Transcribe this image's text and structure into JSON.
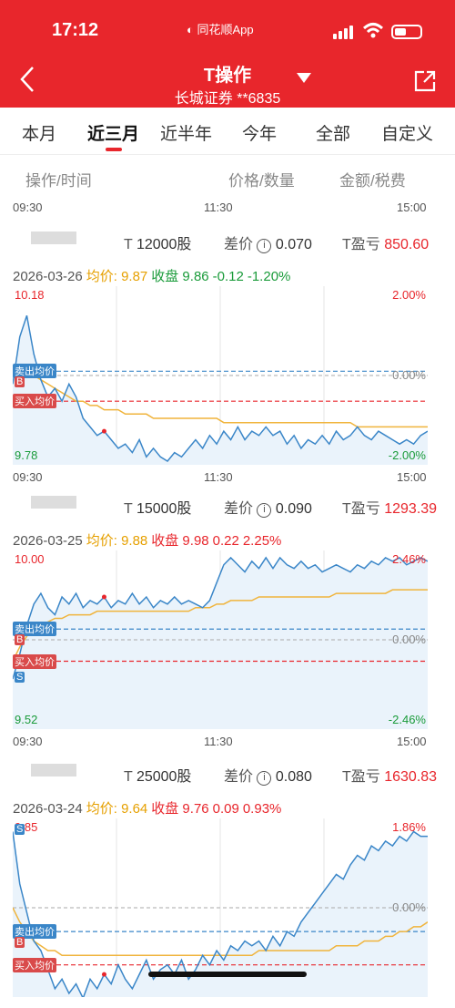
{
  "status_bar": {
    "time": "17:12",
    "app_note": "同花顺App"
  },
  "header": {
    "title": "T操作",
    "subtitle": "长城证券 **6835"
  },
  "tabs": [
    {
      "label": "本月",
      "active": false
    },
    {
      "label": "近三月",
      "active": true
    },
    {
      "label": "近半年",
      "active": false
    },
    {
      "label": "今年",
      "active": false
    },
    {
      "label": "全部",
      "active": false
    },
    {
      "label": "自定义",
      "active": false
    }
  ],
  "columns": {
    "op_time": "操作/时间",
    "price_qty": "价格/数量",
    "amount_fee": "金额/税费"
  },
  "time_labels": {
    "start": "09:30",
    "mid": "11:30",
    "end": "15:00"
  },
  "labels": {
    "t_prefix": "T",
    "diff": "差价",
    "t_pnl": "T盈亏",
    "avg": "均价:",
    "close": "收盘",
    "sell_avg": "卖出均价",
    "buy_avg": "买入均价",
    "sell": "S",
    "buy": "B"
  },
  "colors": {
    "brand": "#e8262c",
    "price_line": "#3a86c8",
    "avg_line": "#f0b43c",
    "sell_line": "#3a86c8",
    "buy_line": "#e8262c"
  },
  "trades": [
    {
      "qty": "12000股",
      "diff": "0.070",
      "pnl": "850.60",
      "date": "2026-03-26",
      "avg": "9.87",
      "close": "9.86",
      "chg": "-0.12",
      "pct": "-1.20%",
      "hi": "10.18",
      "lo": "9.78",
      "hi_pct": "2.00%",
      "mid_pct": "0.00%",
      "lo_pct": "-2.00%",
      "chart_data": {
        "type": "line",
        "y_range": [
          9.78,
          10.18
        ],
        "open_ref": 9.98,
        "sell_avg": 9.99,
        "buy_avg": 9.92,
        "price": [
          9.96,
          10.07,
          10.12,
          10.03,
          9.97,
          9.93,
          9.95,
          9.92,
          9.96,
          9.93,
          9.88,
          9.86,
          9.84,
          9.85,
          9.83,
          9.81,
          9.82,
          9.8,
          9.83,
          9.79,
          9.81,
          9.79,
          9.78,
          9.8,
          9.79,
          9.81,
          9.83,
          9.81,
          9.84,
          9.82,
          9.85,
          9.83,
          9.86,
          9.83,
          9.85,
          9.84,
          9.86,
          9.84,
          9.85,
          9.82,
          9.84,
          9.81,
          9.83,
          9.82,
          9.84,
          9.82,
          9.85,
          9.83,
          9.84,
          9.86,
          9.84,
          9.83,
          9.85,
          9.84,
          9.83,
          9.82,
          9.83,
          9.82,
          9.84,
          9.85
        ],
        "avg": [
          9.99,
          10.0,
          9.99,
          9.98,
          9.97,
          9.96,
          9.95,
          9.94,
          9.93,
          9.92,
          9.92,
          9.91,
          9.91,
          9.9,
          9.9,
          9.9,
          9.89,
          9.89,
          9.89,
          9.89,
          9.88,
          9.88,
          9.88,
          9.88,
          9.88,
          9.88,
          9.88,
          9.88,
          9.88,
          9.88,
          9.87,
          9.87,
          9.87,
          9.87,
          9.87,
          9.87,
          9.87,
          9.87,
          9.87,
          9.87,
          9.87,
          9.87,
          9.87,
          9.87,
          9.87,
          9.87,
          9.87,
          9.87,
          9.87,
          9.86,
          9.86,
          9.86,
          9.86,
          9.86,
          9.86,
          9.86,
          9.86,
          9.86,
          9.86,
          9.86
        ]
      }
    },
    {
      "qty": "15000股",
      "diff": "0.090",
      "pnl": "1293.39",
      "date": "2026-03-25",
      "avg": "9.88",
      "close": "9.98",
      "chg": "0.22",
      "pct": "2.25%",
      "hi": "10.00",
      "lo": "9.52",
      "hi_pct": "2.46%",
      "mid_pct": "0.00%",
      "lo_pct": "-2.46%",
      "chart_data": {
        "type": "line",
        "y_range": [
          9.52,
          10.0
        ],
        "open_ref": 9.76,
        "sell_avg": 9.79,
        "buy_avg": 9.7,
        "price": [
          9.65,
          9.72,
          9.8,
          9.86,
          9.89,
          9.85,
          9.83,
          9.88,
          9.86,
          9.89,
          9.85,
          9.87,
          9.86,
          9.88,
          9.85,
          9.87,
          9.86,
          9.89,
          9.86,
          9.88,
          9.85,
          9.87,
          9.86,
          9.88,
          9.86,
          9.87,
          9.86,
          9.85,
          9.87,
          9.92,
          9.97,
          9.99,
          9.97,
          9.95,
          9.98,
          9.96,
          9.99,
          9.96,
          9.99,
          9.97,
          9.96,
          9.98,
          9.96,
          9.97,
          9.95,
          9.96,
          9.97,
          9.96,
          9.95,
          9.97,
          9.96,
          9.98,
          9.97,
          9.99,
          9.98,
          9.99,
          9.97,
          9.98,
          9.99,
          9.98
        ],
        "avg": [
          9.7,
          9.74,
          9.77,
          9.79,
          9.8,
          9.81,
          9.82,
          9.82,
          9.83,
          9.83,
          9.83,
          9.83,
          9.84,
          9.84,
          9.84,
          9.84,
          9.84,
          9.84,
          9.84,
          9.84,
          9.84,
          9.84,
          9.84,
          9.84,
          9.84,
          9.84,
          9.85,
          9.85,
          9.85,
          9.86,
          9.86,
          9.87,
          9.87,
          9.87,
          9.87,
          9.88,
          9.88,
          9.88,
          9.88,
          9.88,
          9.88,
          9.88,
          9.88,
          9.88,
          9.88,
          9.88,
          9.89,
          9.89,
          9.89,
          9.89,
          9.89,
          9.89,
          9.89,
          9.89,
          9.9,
          9.9,
          9.9,
          9.9,
          9.9,
          9.9
        ]
      }
    },
    {
      "qty": "25000股",
      "diff": "0.080",
      "pnl": "1630.83",
      "date": "2026-03-24",
      "avg": "9.64",
      "close": "9.76",
      "chg": "0.09",
      "pct": "0.93%",
      "hi": "9.85",
      "lo": "",
      "hi_pct": "1.86%",
      "mid_pct": "0.00%",
      "lo_pct": "",
      "chart_data": {
        "type": "line",
        "y_range": [
          9.49,
          9.85
        ],
        "open_ref": 9.67,
        "sell_avg": 9.62,
        "buy_avg": 9.55,
        "price": [
          9.83,
          9.72,
          9.66,
          9.6,
          9.58,
          9.54,
          9.5,
          9.52,
          9.49,
          9.51,
          9.48,
          9.52,
          9.5,
          9.53,
          9.51,
          9.55,
          9.52,
          9.5,
          9.53,
          9.56,
          9.52,
          9.54,
          9.55,
          9.53,
          9.56,
          9.52,
          9.54,
          9.57,
          9.55,
          9.58,
          9.56,
          9.59,
          9.58,
          9.6,
          9.59,
          9.6,
          9.58,
          9.61,
          9.59,
          9.62,
          9.61,
          9.64,
          9.66,
          9.68,
          9.7,
          9.72,
          9.74,
          9.73,
          9.76,
          9.78,
          9.77,
          9.8,
          9.79,
          9.81,
          9.8,
          9.82,
          9.81,
          9.83,
          9.82,
          9.82
        ],
        "avg": [
          9.67,
          9.64,
          9.62,
          9.6,
          9.59,
          9.58,
          9.58,
          9.57,
          9.57,
          9.57,
          9.57,
          9.57,
          9.57,
          9.57,
          9.57,
          9.57,
          9.57,
          9.57,
          9.57,
          9.57,
          9.57,
          9.57,
          9.57,
          9.57,
          9.57,
          9.57,
          9.57,
          9.57,
          9.57,
          9.57,
          9.57,
          9.57,
          9.57,
          9.57,
          9.57,
          9.58,
          9.58,
          9.58,
          9.58,
          9.58,
          9.58,
          9.58,
          9.58,
          9.58,
          9.58,
          9.58,
          9.59,
          9.59,
          9.59,
          9.59,
          9.6,
          9.6,
          9.6,
          9.61,
          9.61,
          9.62,
          9.62,
          9.63,
          9.63,
          9.64
        ]
      }
    }
  ]
}
